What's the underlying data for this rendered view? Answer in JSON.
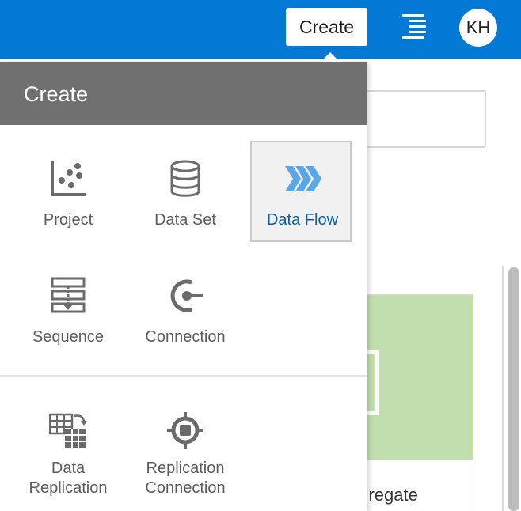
{
  "header": {
    "create_label": "Create",
    "avatar_initials": "KH"
  },
  "background": {
    "card_title_fragment": "ggregate"
  },
  "popup": {
    "title": "Create",
    "items": [
      {
        "label": "Project",
        "icon": "scatter-chart-icon"
      },
      {
        "label": "Data Set",
        "icon": "database-icon"
      },
      {
        "label": "Data Flow",
        "icon": "data-flow-chevrons-icon",
        "selected": true
      },
      {
        "label": "Sequence",
        "icon": "sequence-icon"
      },
      {
        "label": "Connection",
        "icon": "connection-plug-icon"
      }
    ],
    "replication_items": [
      {
        "label_line1": "Data",
        "label_line2": "Replication",
        "icon": "data-replication-icon"
      },
      {
        "label_line1": "Replication",
        "label_line2": "Connection",
        "icon": "replication-connection-icon"
      }
    ]
  },
  "colors": {
    "topbar": "#0378d4",
    "popup_header": "#707070",
    "icon_gray": "#6b6b6b",
    "data_flow_blue": "#5aa7e6",
    "selected_text": "#0d5fa0",
    "card_thumb": "#c1deae"
  }
}
